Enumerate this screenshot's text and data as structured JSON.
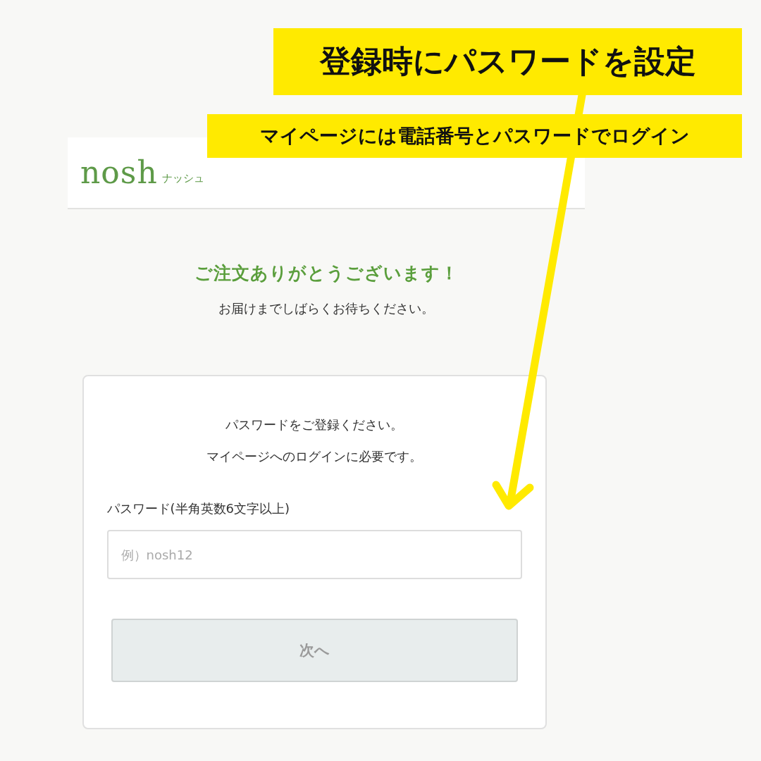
{
  "annotations": [
    {
      "text": "登録時にパスワードを設定",
      "kind": "title"
    },
    {
      "text": "マイページには電話番号とパスワードでログイン",
      "kind": "subtitle"
    }
  ],
  "header": {
    "logo": "nosh",
    "logo_kana": "ナッシュ"
  },
  "thanks": {
    "title": "ご注文ありがとうございます！",
    "message": "お届けまでしばらくお待ちください。"
  },
  "card": {
    "lines": [
      "パスワードをご登録ください。",
      "マイページへのログインに必要です。"
    ],
    "field": {
      "label": "パスワード(半角英数6文字以上)",
      "placeholder": "例）nosh12"
    },
    "button": {
      "label": "次へ",
      "disabled": true
    }
  }
}
